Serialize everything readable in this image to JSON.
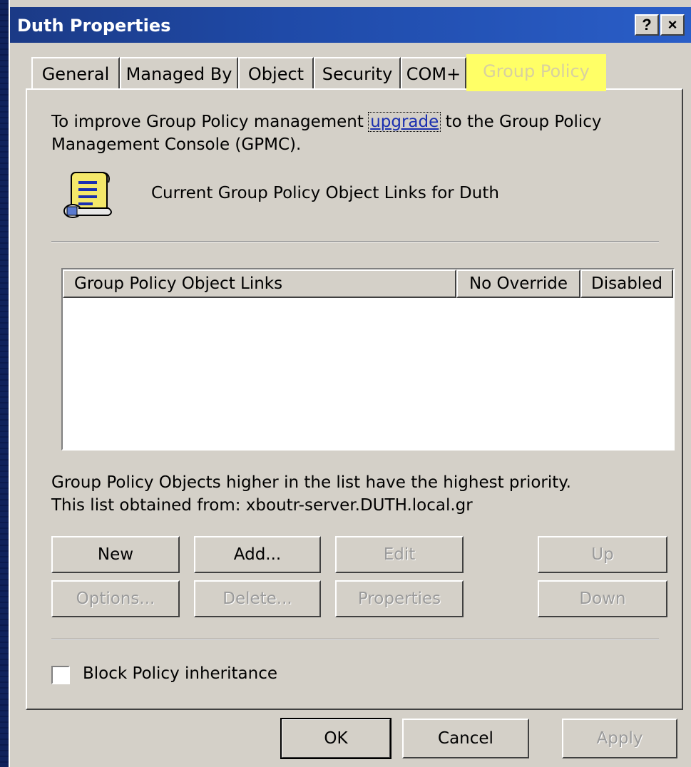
{
  "window": {
    "title": "Duth Properties",
    "help_glyph": "?",
    "close_glyph": "×"
  },
  "tabs": [
    {
      "label": "General",
      "active": false
    },
    {
      "label": "Managed By",
      "active": false
    },
    {
      "label": "Object",
      "active": false
    },
    {
      "label": "Security",
      "active": false
    },
    {
      "label": "COM+",
      "active": false
    },
    {
      "label": "Group Policy",
      "active": true
    }
  ],
  "upgrade_notice": {
    "prefix": "To improve Group Policy management ",
    "link": "upgrade",
    "suffix": " to the Group Policy",
    "line2": "Management Console (GPMC)."
  },
  "current_links_label": "Current Group Policy Object Links for Duth",
  "list": {
    "columns": [
      "Group Policy Object Links",
      "No Override",
      "Disabled"
    ],
    "rows": []
  },
  "priority_note": "Group Policy Objects higher in the list have the highest priority.",
  "obtained_from": "This list obtained from: xboutr-server.DUTH.local.gr",
  "buttons": {
    "new": "New",
    "add": "Add...",
    "edit": "Edit",
    "up": "Up",
    "options": "Options...",
    "delete": "Delete...",
    "properties": "Properties",
    "down": "Down"
  },
  "block_inheritance": {
    "label": "Block Policy inheritance",
    "checked": false
  },
  "footer": {
    "ok": "OK",
    "cancel": "Cancel",
    "apply": "Apply"
  },
  "colors": {
    "dialog_face": "#d4d0c8",
    "title_bar": "#1f4aa8",
    "highlight_tab": "#ffff66",
    "link": "#1a2fb0"
  },
  "icons": {
    "policy_scroll": "scroll-icon"
  }
}
